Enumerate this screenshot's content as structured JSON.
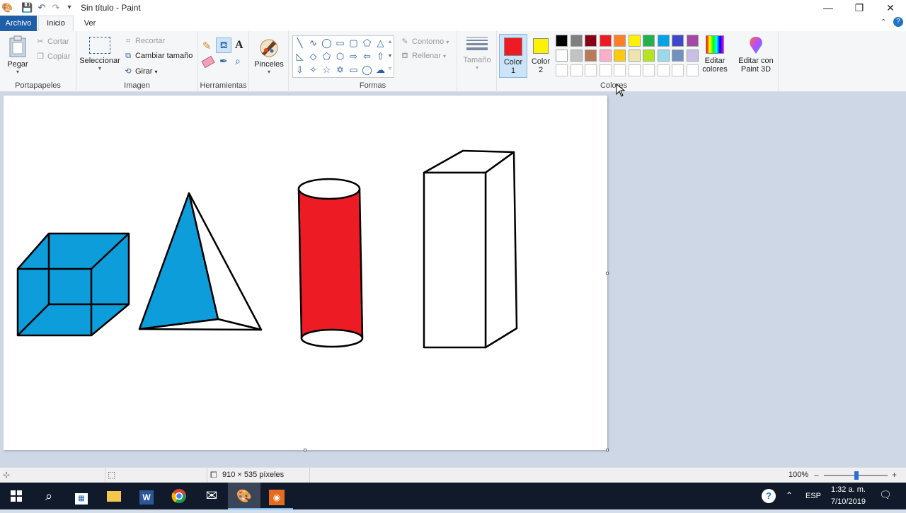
{
  "window": {
    "title": "Sin título - Paint",
    "minimize_glyph": "—",
    "restore_glyph": "❐",
    "close_glyph": "✕"
  },
  "tabs": {
    "file": "Archivo",
    "home": "Inicio",
    "view": "Ver"
  },
  "clipboard": {
    "paste": "Pegar",
    "cut": "Cortar",
    "copy": "Copiar",
    "group": "Portapapeles"
  },
  "image": {
    "select": "Seleccionar",
    "crop": "Recortar",
    "resize": "Cambiar tamaño",
    "rotate": "Girar",
    "group": "Imagen"
  },
  "tools": {
    "group": "Herramientas",
    "text_glyph": "A"
  },
  "brushes": {
    "label": "Pinceles"
  },
  "shapes": {
    "outline": "Contorno",
    "fill": "Rellenar",
    "group": "Formas"
  },
  "size": {
    "label": "Tamaño"
  },
  "colors": {
    "color1_label": "Color",
    "color1_num": "1",
    "color2_label": "Color",
    "color2_num": "2",
    "color1_value": "#ed1c24",
    "color2_value": "#fff200",
    "edit_colors": "Editar colores",
    "edit_paint3d": "Editar con Paint 3D",
    "group": "Colores",
    "palette_row1": [
      "#000000",
      "#7f7f7f",
      "#880015",
      "#ed1c24",
      "#ff7f27",
      "#fff200",
      "#22b14c",
      "#00a2e8",
      "#3f48cc",
      "#a349a4"
    ],
    "palette_row2": [
      "#ffffff",
      "#c3c3c3",
      "#b97a57",
      "#ffaec9",
      "#ffc90e",
      "#efe4b0",
      "#b5e61d",
      "#99d9ea",
      "#7092be",
      "#c8bfe7"
    ]
  },
  "drawing": {
    "cube_color": "#0d9ddb",
    "pyramid_color": "#0d9ddb",
    "cylinder_color": "#ed1c24",
    "prism_color": "#ffffff"
  },
  "status": {
    "dimensions": "910 × 535 píxeles",
    "zoom": "100%"
  },
  "taskbar": {
    "language": "ESP",
    "time": "1:32 a. m.",
    "date": "7/10/2019"
  }
}
